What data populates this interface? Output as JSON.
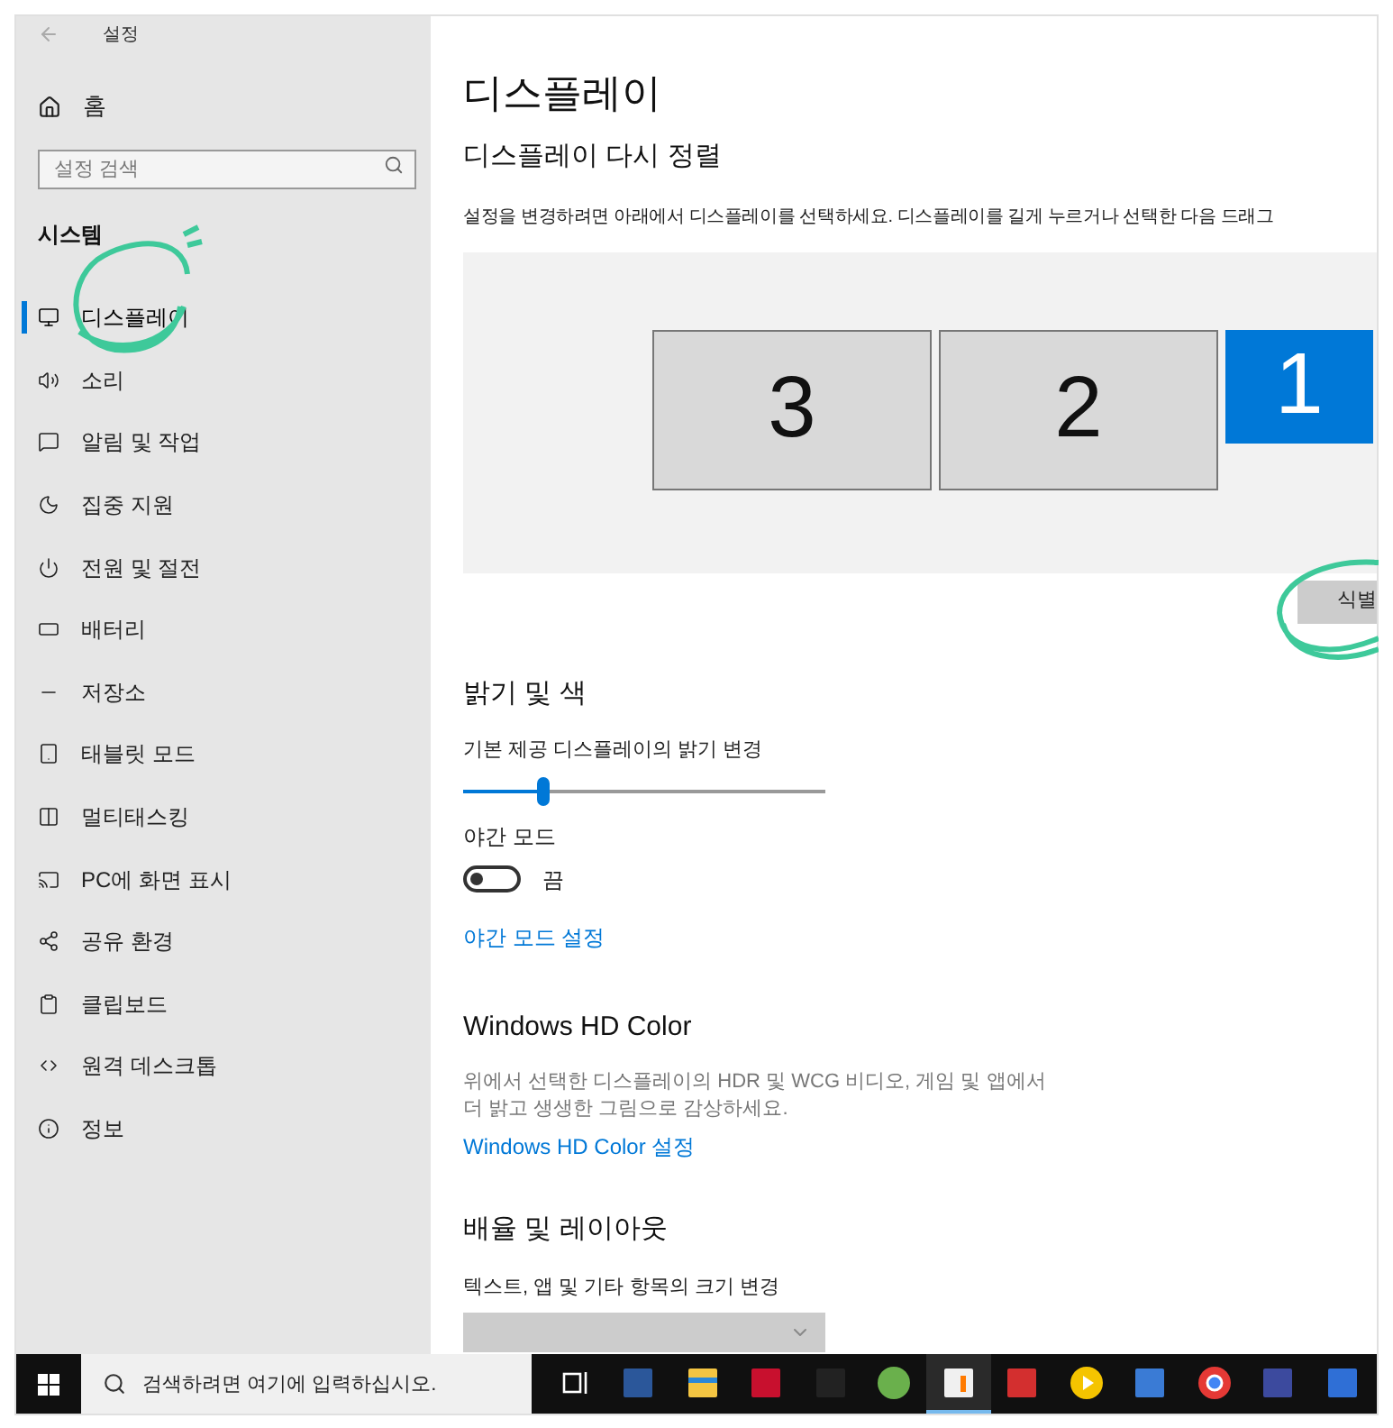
{
  "window": {
    "title": "설정"
  },
  "sidebar": {
    "home": "홈",
    "search": {
      "placeholder": "설정 검색"
    },
    "section": "시스템",
    "items": [
      {
        "label": "디스플레이",
        "selected": true
      },
      {
        "label": "소리",
        "selected": false
      },
      {
        "label": "알림 및 작업",
        "selected": false
      },
      {
        "label": "집중 지원",
        "selected": false
      },
      {
        "label": "전원 및 절전",
        "selected": false
      },
      {
        "label": "배터리",
        "selected": false
      },
      {
        "label": "저장소",
        "selected": false
      },
      {
        "label": "태블릿 모드",
        "selected": false
      },
      {
        "label": "멀티태스킹",
        "selected": false
      },
      {
        "label": "PC에 화면 표시",
        "selected": false
      },
      {
        "label": "공유 환경",
        "selected": false
      },
      {
        "label": "클립보드",
        "selected": false
      },
      {
        "label": "원격 데스크톱",
        "selected": false
      },
      {
        "label": "정보",
        "selected": false
      }
    ]
  },
  "main": {
    "title": "디스플레이",
    "arrange": {
      "heading": "디스플레이 다시 정렬",
      "description": "설정을 변경하려면 아래에서 디스플레이를 선택하세요. 디스플레이를 길게 누르거나 선택한 다음 드래그",
      "monitors": [
        {
          "number": "3",
          "selected": false
        },
        {
          "number": "2",
          "selected": false
        },
        {
          "number": "1",
          "selected": true
        }
      ],
      "identify_button": "식별"
    },
    "brightness": {
      "heading": "밝기 및 색",
      "slider_label": "기본 제공 디스플레이의 밝기 변경",
      "level": 0.22,
      "night_mode_label": "야간 모드",
      "night_mode": {
        "on": false,
        "state_text": "끔"
      },
      "night_link": "야간 모드 설정"
    },
    "hdr": {
      "heading": "Windows HD Color",
      "description": "위에서 선택한 디스플레이의 HDR 및 WCG 비디오, 게임 및 앱에서\n더 밝고 생생한 그림으로 감상하세요.",
      "link": "Windows HD Color 설정"
    },
    "scale": {
      "heading": "배율 및 레이아웃",
      "label": "텍스트, 앱 및 기타 항목의 크기 변경"
    }
  },
  "taskbar": {
    "search": {
      "placeholder": "검색하려면 여기에 입력하십시오."
    },
    "apps": [
      {
        "kind": "taskview",
        "selected": false
      },
      {
        "kind": "calculator",
        "selected": false
      },
      {
        "kind": "folder",
        "selected": false
      },
      {
        "kind": "redart",
        "selected": false
      },
      {
        "kind": "terminal",
        "selected": false
      },
      {
        "kind": "torrent",
        "selected": false
      },
      {
        "kind": "recorder",
        "selected": true
      },
      {
        "kind": "redbox",
        "selected": false
      },
      {
        "kind": "player",
        "selected": false
      },
      {
        "kind": "diamond",
        "selected": false
      },
      {
        "kind": "browser",
        "selected": false
      },
      {
        "kind": "dev",
        "selected": false
      },
      {
        "kind": "bluebox",
        "selected": false
      }
    ]
  }
}
